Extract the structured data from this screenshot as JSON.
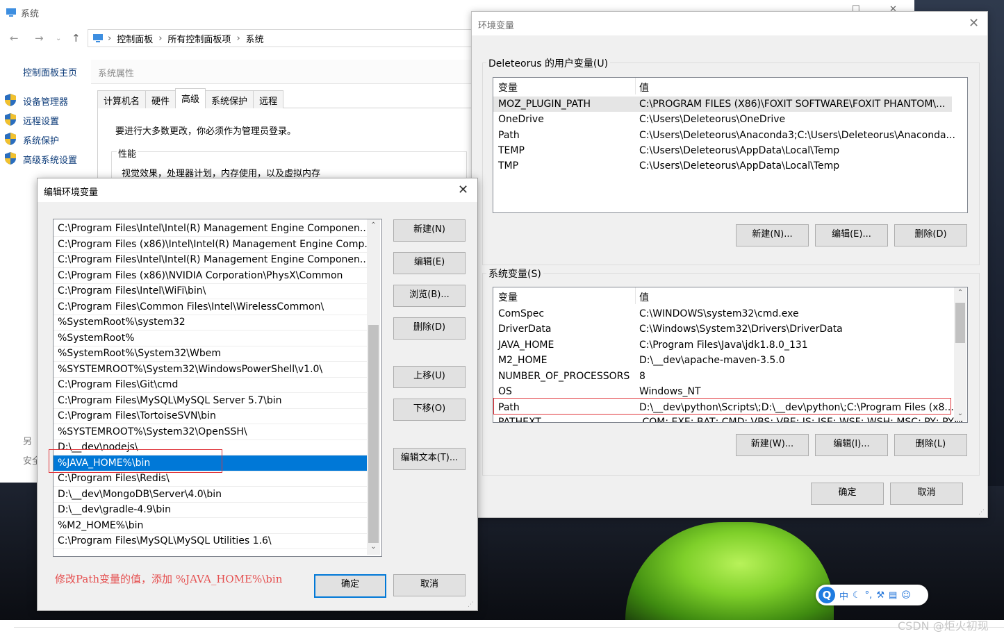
{
  "system_window": {
    "title": "系统",
    "breadcrumb": [
      "控制面板",
      "所有控制面板项",
      "系统"
    ],
    "sidebar": {
      "home": "控制面板主页",
      "links": [
        "设备管理器",
        "远程设置",
        "系统保护",
        "高级系统设置"
      ],
      "cut_items": [
        "另",
        "安全"
      ]
    },
    "properties": {
      "title": "系统属性",
      "tabs": [
        "计算机名",
        "硬件",
        "高级",
        "系统保护",
        "远程"
      ],
      "active_tab": "高级",
      "admin_note": "要进行大多数更改，你必须作为管理员登录。",
      "performance_label": "性能",
      "performance_desc": "视觉效果，处理器计划，内存使用，以及虚拟内存"
    }
  },
  "env_dialog": {
    "title": "环境变量",
    "user_group_label": "Deleteorus 的用户变量(U)",
    "columns": [
      "变量",
      "值"
    ],
    "user_vars": [
      {
        "name": "MOZ_PLUGIN_PATH",
        "value": "C:\\PROGRAM FILES (X86)\\FOXIT SOFTWARE\\FOXIT PHANTOM\\..."
      },
      {
        "name": "OneDrive",
        "value": "C:\\Users\\Deleteorus\\OneDrive"
      },
      {
        "name": "Path",
        "value": "C:\\Users\\Deleteorus\\Anaconda3;C:\\Users\\Deleteorus\\Anaconda..."
      },
      {
        "name": "TEMP",
        "value": "C:\\Users\\Deleteorus\\AppData\\Local\\Temp"
      },
      {
        "name": "TMP",
        "value": "C:\\Users\\Deleteorus\\AppData\\Local\\Temp"
      }
    ],
    "user_buttons": [
      "新建(N)...",
      "编辑(E)...",
      "删除(D)"
    ],
    "sys_group_label": "系统变量(S)",
    "sys_vars": [
      {
        "name": "ComSpec",
        "value": "C:\\WINDOWS\\system32\\cmd.exe"
      },
      {
        "name": "DriverData",
        "value": "C:\\Windows\\System32\\Drivers\\DriverData"
      },
      {
        "name": "JAVA_HOME",
        "value": "C:\\Program Files\\Java\\jdk1.8.0_131"
      },
      {
        "name": "M2_HOME",
        "value": "D:\\__dev\\apache-maven-3.5.0"
      },
      {
        "name": "NUMBER_OF_PROCESSORS",
        "value": "8"
      },
      {
        "name": "OS",
        "value": "Windows_NT"
      },
      {
        "name": "Path",
        "value": "D:\\__dev\\python\\Scripts\\;D:\\__dev\\python\\;C:\\Program Files (x8..."
      },
      {
        "name": "PATHEXT",
        "value": ".COM;.EXE;.BAT;.CMD;.VBS;.VBE;.JS;.JSE;.WSF;.WSH;.MSC;.PY;.PYW"
      }
    ],
    "sys_buttons": [
      "新建(W)...",
      "编辑(I)...",
      "删除(L)"
    ],
    "ok": "确定",
    "cancel": "取消"
  },
  "edit_dialog": {
    "title": "编辑环境变量",
    "entries": [
      "C:\\Program Files\\Intel\\Intel(R) Management Engine Componen...",
      "C:\\Program Files (x86)\\Intel\\Intel(R) Management Engine Comp...",
      "C:\\Program Files\\Intel\\Intel(R) Management Engine Componen...",
      "C:\\Program Files (x86)\\NVIDIA Corporation\\PhysX\\Common",
      "C:\\Program Files\\Intel\\WiFi\\bin\\",
      "C:\\Program Files\\Common Files\\Intel\\WirelessCommon\\",
      "%SystemRoot%\\system32",
      "%SystemRoot%",
      "%SystemRoot%\\System32\\Wbem",
      "%SYSTEMROOT%\\System32\\WindowsPowerShell\\v1.0\\",
      "C:\\Program Files\\Git\\cmd",
      "C:\\Program Files\\MySQL\\MySQL Server 5.7\\bin",
      "C:\\Program Files\\TortoiseSVN\\bin",
      "%SYSTEMROOT%\\System32\\OpenSSH\\",
      "D:\\__dev\\nodejs\\",
      "%JAVA_HOME%\\bin",
      "C:\\Program Files\\Redis\\",
      "D:\\__dev\\MongoDB\\Server\\4.0\\bin",
      "D:\\__dev\\gradle-4.9\\bin",
      "%M2_HOME%\\bin",
      "C:\\Program Files\\MySQL\\MySQL Utilities 1.6\\"
    ],
    "selected_index": 15,
    "buttons": {
      "new": "新建(N)",
      "edit": "编辑(E)",
      "browse": "浏览(B)...",
      "delete": "删除(D)",
      "move_up": "上移(U)",
      "move_down": "下移(O)",
      "edit_text": "编辑文本(T)..."
    },
    "ok": "确定",
    "cancel": "取消",
    "annotation": "修改Path变量的值，添加 %JAVA_HOME%\\bin"
  },
  "ime_bar": {
    "items": [
      "中",
      "☾",
      "°,",
      "⚒",
      "▤",
      "☺"
    ]
  },
  "watermark": "CSDN @炬火初现",
  "colors": {
    "accent": "#0078d7",
    "highlight_box": "#e0353b",
    "annotation": "#e55050"
  }
}
